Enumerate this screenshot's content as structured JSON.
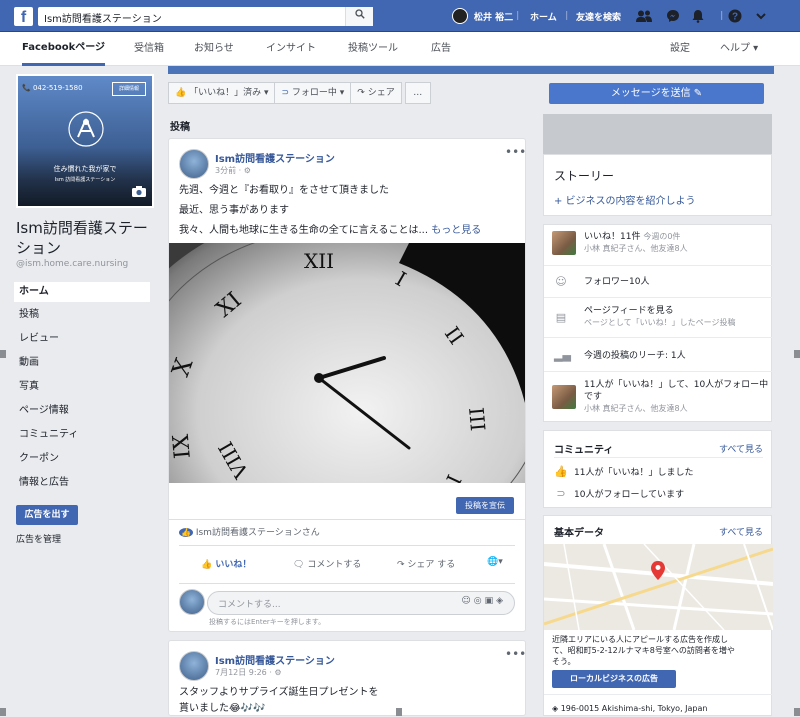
{
  "topbar": {
    "search_value": "Ism訪問看護ステーション",
    "user_name": "松井 裕二",
    "home_label": "ホーム",
    "find_friends_label": "友達を検索"
  },
  "subnav": {
    "tabs": [
      "Facebookページ",
      "受信箱",
      "お知らせ",
      "インサイト",
      "投稿ツール",
      "広告"
    ],
    "settings_label": "設定",
    "help_label": "ヘルプ ▾"
  },
  "cover": {
    "phone": "042-519-1580",
    "button": "詳細情報",
    "headline": "住み慣れた我が家で",
    "subline": "Ism 訪問看護ステーション"
  },
  "page": {
    "name": "Ism訪問看護ステーション",
    "handle": "@ism.home.care.nursing"
  },
  "left_nav": [
    "ホーム",
    "投稿",
    "レビュー",
    "動画",
    "写真",
    "ページ情報",
    "コミュニティ",
    "クーポン",
    "情報と広告"
  ],
  "left_actions": {
    "create_ad": "広告を出す",
    "manage_ads": "広告を管理"
  },
  "actionbar": {
    "like": "「いいね！」済み ▾",
    "follow": "フォロー中 ▾",
    "share": "シェア",
    "more": "…",
    "send_message": "メッセージを送信 ✎"
  },
  "posts_title": "投稿",
  "post1": {
    "author": "Ism訪問看護ステーション",
    "time": "3分前 ·",
    "lines": [
      "先週、今週と『お看取り』をさせて頂きました",
      "最近、思う事があります",
      "我々、人間も地球に生きる生命の全てに言えることは..."
    ],
    "more": "もっと見る",
    "boost": "投稿を宣伝",
    "liked_by": "Ism訪問看護ステーションさん",
    "like": "いいね！",
    "comment": "コメントする",
    "share": "シェア する",
    "comment_placeholder": "コメントする...",
    "enter_hint": "投稿するにはEnterキーを押します。"
  },
  "post2": {
    "author": "Ism訪問看護ステーション",
    "time": "7月12日 9:26 ·",
    "lines": [
      "スタッフよりサプライズ誕生日プレゼントを",
      "貰いました😂🎶🎶"
    ]
  },
  "right": {
    "story_title": "ストーリー",
    "story_link": "+ ビジネスの内容を紹介しよう",
    "likes_line": "いいね！11件",
    "likes_today": "今週の0件",
    "likes_sub": "小林 真紀子さん、他友達8人",
    "followers": "フォロワー10人",
    "feed_line": "ページフィードを見る",
    "feed_sub": "ページとして「いいね！」したページ投稿",
    "reach": "今週の投稿のリーチ: 1人",
    "summary_line1": "11人が「いいね！」して、10人がフォロー中",
    "summary_line2": "です",
    "summary_sub": "小林 真紀子さん、他友達8人",
    "community_title": "コミュニティ",
    "see_all": "すべて見る",
    "community_likes": "11人が「いいね！」しました",
    "community_follows": "10人がフォローしています",
    "basic_title": "基本データ",
    "local_text1": "近隣エリアにいる人にアピールする広告を作成し",
    "local_text2": "て、昭和町5-2-12ルナマキ8号室への訪問者を増や",
    "local_text3": "そう。",
    "local_ad": "ローカルビジネスの広告",
    "address": "196-0015 Akishima-shi, Tokyo, Japan"
  },
  "colors": {
    "brand": "#4267b2",
    "link": "#365899",
    "bg": "#e9ebee"
  }
}
